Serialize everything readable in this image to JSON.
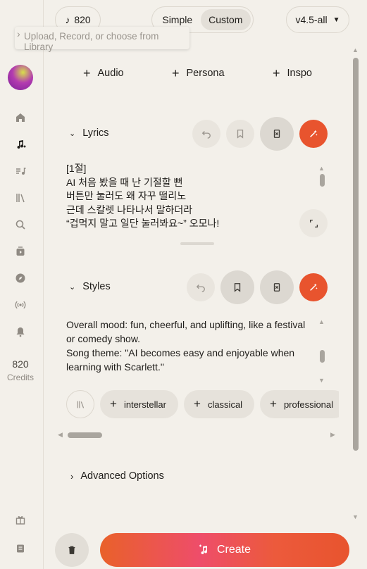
{
  "header": {
    "credits_badge": "820",
    "mode_simple": "Simple",
    "mode_custom": "Custom",
    "model": "v4.5-all",
    "tooltip": "Upload, Record, or choose from Library"
  },
  "sidebar": {
    "credits_count": "820",
    "credits_label": "Credits",
    "icons": [
      "home-icon",
      "create-music-icon",
      "playlist-add-icon",
      "library-icon",
      "search-icon",
      "video-icon",
      "explore-icon",
      "radio-icon",
      "notification-icon",
      "gift-icon",
      "notes-icon"
    ]
  },
  "add_row": {
    "audio": "Audio",
    "persona": "Persona",
    "inspo": "Inspo"
  },
  "lyrics": {
    "title": "Lyrics",
    "lines": [
      "[1절]",
      "AI 처음 봤을 때 난 기절할 뻔",
      "버튼만 눌러도 왜 자꾸 떨리노",
      "근데 스칼렛 나타나서 말하더라",
      "“겁먹지 말고 일단 눌러봐요~” 오모나!"
    ]
  },
  "styles": {
    "title": "Styles",
    "text_line1": "Overall mood: fun, cheerful, and uplifting, like a festival or comedy show.",
    "text_line2": "Song theme: \"AI becomes easy and enjoyable when learning with Scarlett.\"",
    "tags": [
      "interstellar",
      "classical",
      "professional"
    ]
  },
  "advanced": {
    "label": "Advanced Options"
  },
  "footer": {
    "create_label": "Create"
  },
  "colors": {
    "accent": "#e8542e",
    "background": "#f3f0ea"
  }
}
